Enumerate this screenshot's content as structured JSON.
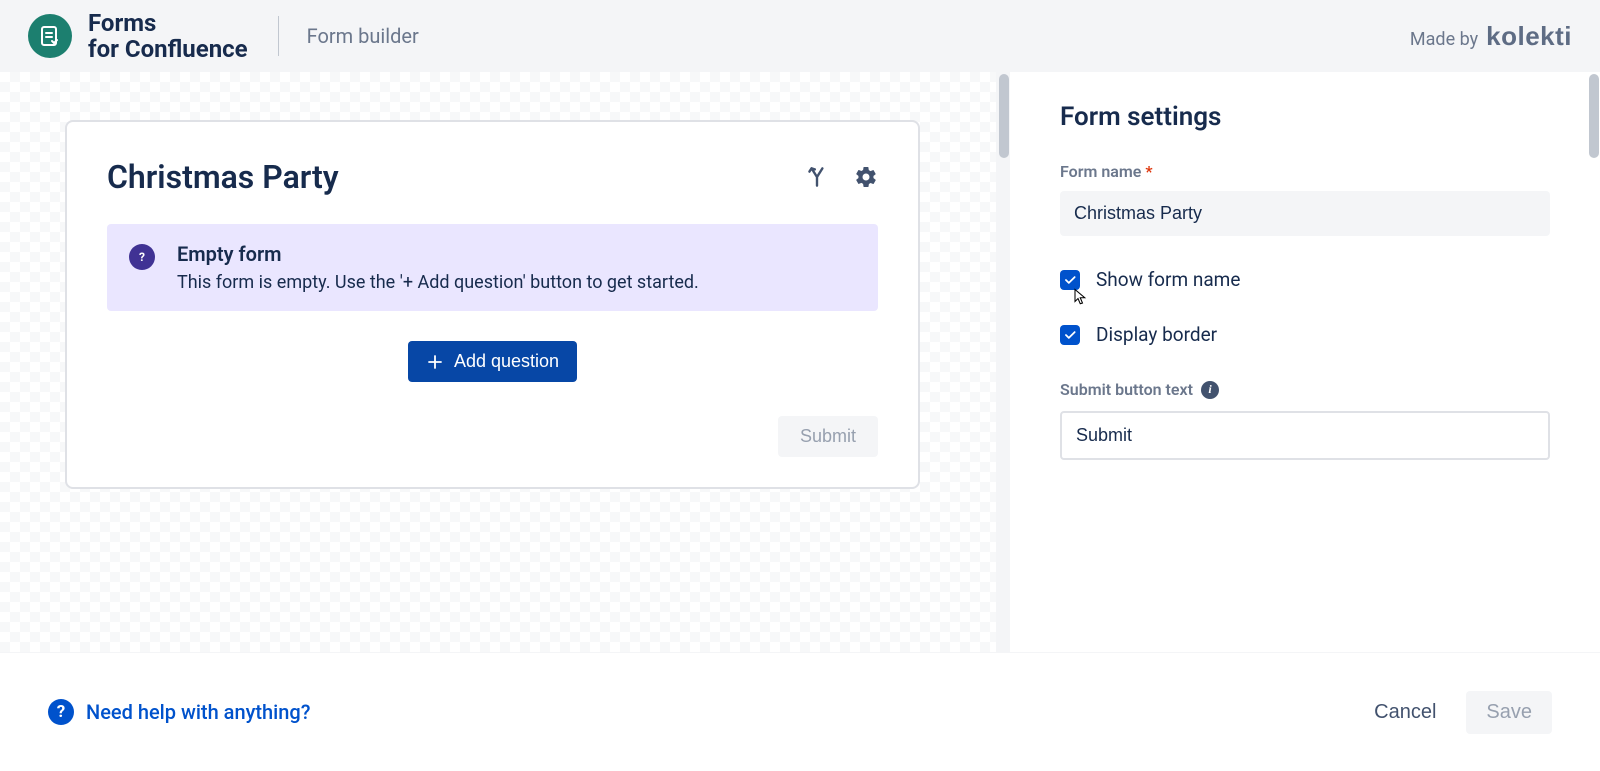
{
  "header": {
    "app_title_line1": "Forms",
    "app_title_line2": "for Confluence",
    "breadcrumb": "Form builder",
    "made_by_label": "Made by",
    "brand": "kolekti"
  },
  "form_preview": {
    "title": "Christmas Party",
    "empty_banner": {
      "title": "Empty form",
      "text": "This form is empty. Use the '+ Add question' button to get started."
    },
    "add_question_label": "Add question",
    "submit_label": "Submit"
  },
  "settings": {
    "heading": "Form settings",
    "form_name_label": "Form name",
    "form_name_value": "Christmas Party",
    "show_form_name": {
      "label": "Show form name",
      "checked": true
    },
    "display_border": {
      "label": "Display border",
      "checked": true
    },
    "submit_text_label": "Submit button text",
    "submit_text_value": "Submit"
  },
  "footer": {
    "help_text": "Need help with anything?",
    "cancel": "Cancel",
    "save": "Save"
  }
}
